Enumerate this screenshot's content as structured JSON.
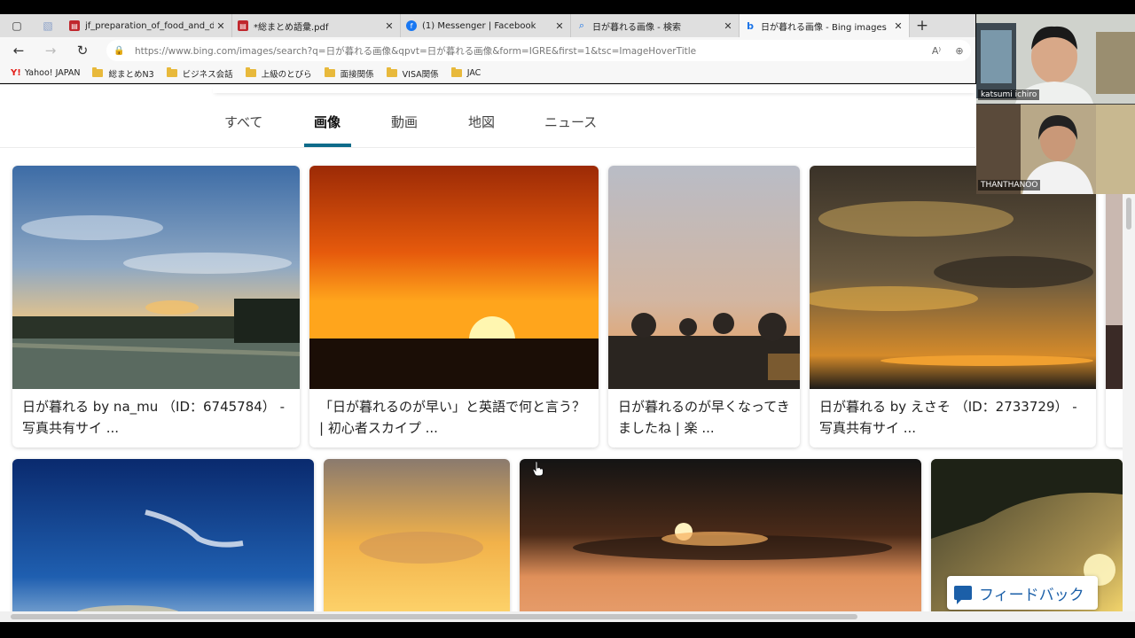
{
  "browser": {
    "tabs": [
      {
        "title": "jf_preparation_of_food_and_drin",
        "favicon": "pdf-icon",
        "favicon_color": "#c0272d",
        "active": false
      },
      {
        "title": "*総まとめ語彙.pdf",
        "favicon": "pdf-icon",
        "favicon_color": "#c0272d",
        "active": false
      },
      {
        "title": "(1) Messenger | Facebook",
        "favicon": "facebook-icon",
        "favicon_color": "#1877f2",
        "active": false
      },
      {
        "title": "日が暮れる画像 - 検索",
        "favicon": "search-icon",
        "favicon_color": "#1a73e8",
        "active": false
      },
      {
        "title": "日が暮れる画像 - Bing images",
        "favicon": "bing-icon",
        "favicon_color": "#1a73e8",
        "active": true
      }
    ],
    "close_glyph": "✕",
    "new_tab_glyph": "+",
    "url": "https://www.bing.com/images/search?q=日が暮れる画像&qpvt=日が暮れる画像&form=IGRE&first=1&tsc=ImageHoverTitle",
    "favorites": [
      {
        "label": "Yahoo! JAPAN",
        "icon": "yahoo-icon"
      },
      {
        "label": "総まとめN3",
        "icon": "folder-icon"
      },
      {
        "label": "ビジネス会話",
        "icon": "folder-icon"
      },
      {
        "label": "上級のとびら",
        "icon": "folder-icon"
      },
      {
        "label": "面接関係",
        "icon": "folder-icon"
      },
      {
        "label": "VISA関係",
        "icon": "folder-icon"
      },
      {
        "label": "JAC",
        "icon": "folder-icon"
      }
    ]
  },
  "search_tabs": [
    {
      "label": "すべて",
      "active": false
    },
    {
      "label": "画像",
      "active": true
    },
    {
      "label": "動画",
      "active": false
    },
    {
      "label": "地図",
      "active": false
    },
    {
      "label": "ニュース",
      "active": false
    }
  ],
  "results_row1": [
    {
      "caption": "日が暮れる by na_mu （ID：6745784） - 写真共有サイ ..."
    },
    {
      "caption": "「日が暮れるのが早い」と英語で何と言う？ | 初心者スカイプ ..."
    },
    {
      "caption": "日が暮れるのが早くなってきましたね | 楽 ..."
    },
    {
      "caption": "日が暮れる by えさそ （ID：2733729） - 写真共有サイ ..."
    }
  ],
  "video_participants": [
    {
      "name": "katsumi ichiro"
    },
    {
      "name": "THANTHANOO"
    }
  ],
  "feedback_label": "フィードバック",
  "colors": {
    "accent": "#0f6b8a",
    "feedback": "#1b5fa8"
  }
}
